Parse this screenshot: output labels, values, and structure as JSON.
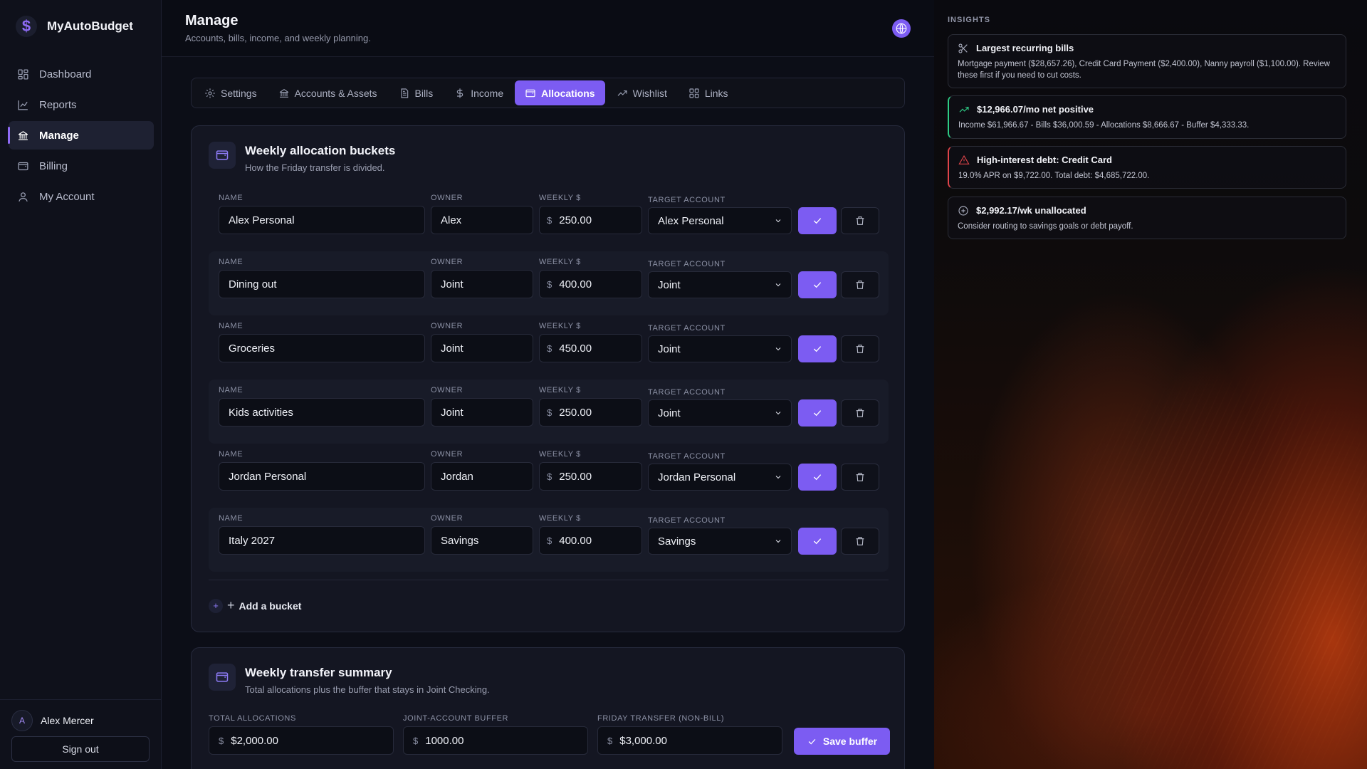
{
  "app": {
    "name": "MyAutoBudget",
    "logo_glyph": "$"
  },
  "sidebar": {
    "items": [
      {
        "label": "Dashboard",
        "icon": "dashboard-icon"
      },
      {
        "label": "Reports",
        "icon": "chart-line-icon"
      },
      {
        "label": "Manage",
        "icon": "bank-icon",
        "active": true
      },
      {
        "label": "Billing",
        "icon": "wallet-icon"
      },
      {
        "label": "My Account",
        "icon": "user-icon"
      }
    ],
    "user": {
      "initial": "A",
      "name": "Alex Mercer"
    },
    "signout_label": "Sign out"
  },
  "header": {
    "title": "Manage",
    "subtitle": "Accounts, bills, income, and weekly planning."
  },
  "tabs": [
    {
      "label": "Settings",
      "icon": "gear-icon"
    },
    {
      "label": "Accounts & Assets",
      "icon": "bank-icon"
    },
    {
      "label": "Bills",
      "icon": "document-icon"
    },
    {
      "label": "Income",
      "icon": "dollar-icon"
    },
    {
      "label": "Allocations",
      "icon": "wallet-icon",
      "active": true
    },
    {
      "label": "Wishlist",
      "icon": "trend-up-icon"
    },
    {
      "label": "Links",
      "icon": "grid-icon"
    }
  ],
  "buckets_card": {
    "title": "Weekly allocation buckets",
    "subtitle": "How the Friday transfer is divided.",
    "labels": {
      "name": "NAME",
      "owner": "OWNER",
      "weekly": "WEEKLY $",
      "target": "TARGET ACCOUNT"
    },
    "currency_symbol": "$",
    "rows": [
      {
        "name": "Alex Personal",
        "owner": "Alex",
        "weekly": "250.00",
        "target": "Alex Personal"
      },
      {
        "name": "Dining out",
        "owner": "Joint",
        "weekly": "400.00",
        "target": "Joint"
      },
      {
        "name": "Groceries",
        "owner": "Joint",
        "weekly": "450.00",
        "target": "Joint"
      },
      {
        "name": "Kids activities",
        "owner": "Joint",
        "weekly": "250.00",
        "target": "Joint"
      },
      {
        "name": "Jordan Personal",
        "owner": "Jordan",
        "weekly": "250.00",
        "target": "Jordan Personal"
      },
      {
        "name": "Italy 2027",
        "owner": "Savings",
        "weekly": "400.00",
        "target": "Savings"
      }
    ],
    "add_icon": "+",
    "add_plus": "+",
    "add_label": "Add a bucket"
  },
  "summary_card": {
    "title": "Weekly transfer summary",
    "subtitle": "Total allocations plus the buffer that stays in Joint Checking.",
    "total_label": "TOTAL ALLOCATIONS",
    "total_value": "$2,000.00",
    "buffer_label": "JOINT-ACCOUNT BUFFER",
    "buffer_value": "1000.00",
    "transfer_label": "FRIDAY TRANSFER (NON-BILL)",
    "transfer_value": "$3,000.00",
    "save_label": "Save buffer"
  },
  "insights": {
    "heading": "INSIGHTS",
    "cards": [
      {
        "icon": "scissors-icon",
        "title": "Largest recurring bills",
        "body": "Mortgage payment ($28,657.26), Credit Card Payment ($2,400.00), Nanny payroll ($1,100.00). Review these first if you need to cut costs."
      },
      {
        "icon": "trend-up-icon",
        "title": "$12,966.07/mo net positive",
        "body": "Income $61,966.67 - Bills $36,000.59 - Allocations $8,666.67 - Buffer $4,333.33."
      },
      {
        "icon": "warning-icon",
        "title": "High-interest debt: Credit Card",
        "body": "19.0% APR on $9,722.00. Total debt: $4,685,722.00."
      },
      {
        "icon": "plus-circle-icon",
        "title": "$2,992.17/wk unallocated",
        "body": "Consider routing to savings goals or debt payoff."
      }
    ]
  },
  "colors": {
    "accent": "#7c5cf2",
    "positive": "#2ecc85",
    "danger": "#e0444a"
  }
}
